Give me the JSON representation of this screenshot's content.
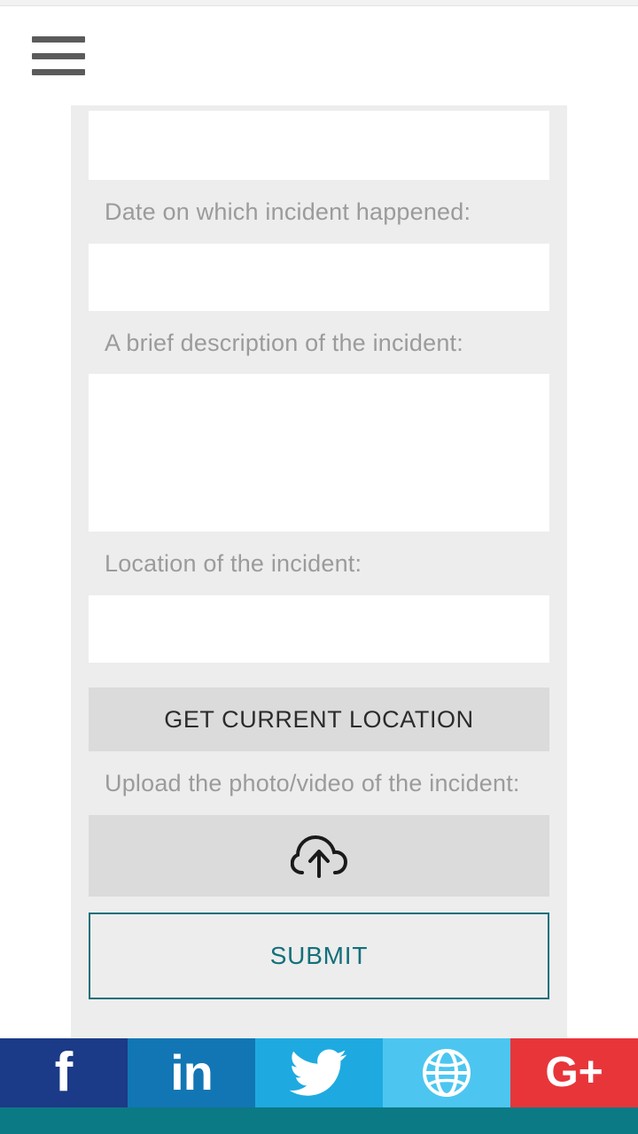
{
  "header": {
    "menu_icon": "hamburger-menu-icon"
  },
  "form": {
    "fields": [
      {
        "label": "",
        "value": "",
        "type": "text"
      },
      {
        "label": "Date on which incident happened:",
        "value": "",
        "type": "text"
      },
      {
        "label": "A brief description of the incident:",
        "value": "",
        "type": "textarea"
      },
      {
        "label": "Location of the incident:",
        "value": "",
        "type": "text"
      }
    ],
    "date_label": "Date on which incident happened:",
    "description_label": "A brief description of the incident:",
    "location_label": "Location of the incident:",
    "upload_label": "Upload the photo/video of the incident:",
    "get_location_button": "GET CURRENT LOCATION",
    "upload_icon": "cloud-upload-icon",
    "submit_button": "SUBMIT"
  },
  "colors": {
    "card_bg": "#ededed",
    "button_grey": "#dbdbdb",
    "submit_accent": "#13707a",
    "facebook": "#1b3a87",
    "linkedin": "#1276b5",
    "twitter": "#1eaae0",
    "website": "#4cc6f0",
    "googleplus": "#e8353a",
    "bottom_strip": "#0b7a84"
  },
  "social": [
    {
      "name": "facebook",
      "glyph": "f",
      "icon": "facebook-icon"
    },
    {
      "name": "linkedin",
      "glyph": "in",
      "icon": "linkedin-icon"
    },
    {
      "name": "twitter",
      "glyph": "🐦",
      "icon": "twitter-icon"
    },
    {
      "name": "website",
      "glyph": "⊕",
      "icon": "globe-icon"
    },
    {
      "name": "googleplus",
      "glyph": "G+",
      "icon": "google-plus-icon"
    }
  ]
}
